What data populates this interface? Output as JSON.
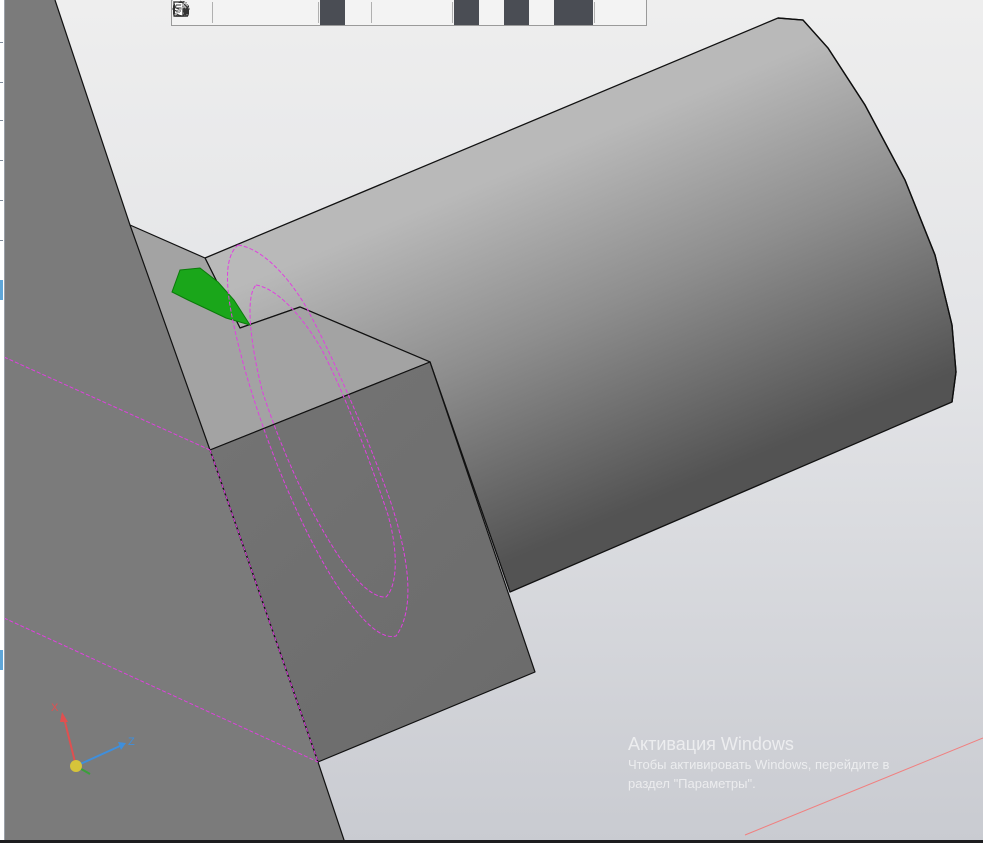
{
  "window": {
    "type": "3d-cad-viewport"
  },
  "toolbar": {
    "buttons": [
      {
        "id": "drag-handle",
        "icon": "grip-icon"
      },
      {
        "id": "orientation",
        "icon": "orientation-icon",
        "has_dropdown": false
      },
      {
        "id": "zoom",
        "icon": "zoom-icon",
        "has_dropdown": true
      },
      {
        "id": "normal-to",
        "icon": "normal-view-icon",
        "has_dropdown": false
      },
      {
        "id": "coordinate-system",
        "icon": "axes-icon",
        "has_dropdown": true
      },
      {
        "id": "shaded",
        "icon": "shaded-cube-icon",
        "active": true
      },
      {
        "id": "wireframe",
        "icon": "wireframe-cube-icon",
        "active": false
      },
      {
        "id": "visibility",
        "icon": "eye-icon",
        "has_dropdown": true
      },
      {
        "id": "display-mode",
        "icon": "camera-icon",
        "has_dropdown": true
      },
      {
        "id": "selection-1",
        "icon": "selection-arrows-icon",
        "active": true
      },
      {
        "id": "selection-2",
        "icon": "sheet-icon",
        "active": false
      },
      {
        "id": "selection-3",
        "icon": "filter-doc-icon",
        "active": true
      },
      {
        "id": "selection-4",
        "icon": "layers-icon",
        "active": false
      },
      {
        "id": "filter",
        "icon": "filter-icon",
        "active": true,
        "has_dropdown": true
      },
      {
        "id": "properties",
        "icon": "properties-icon",
        "active": false
      },
      {
        "id": "eyedropper",
        "icon": "eyedropper-icon",
        "active": false,
        "disabled": true
      }
    ]
  },
  "triad": {
    "x_label": "X",
    "z_label": "Z",
    "x_color": "#e05050",
    "z_color": "#3f8fdc",
    "y_color": "#3aa03a",
    "origin_color": "#d6c43a"
  },
  "watermark": {
    "title": "Активация Windows",
    "line1": "Чтобы активировать Windows, перейдите в",
    "line2": "раздел \"Параметры\"."
  },
  "colors": {
    "selection_face": "#1aa61a",
    "sketch_curve": "#e040e0",
    "body_gray": "#7b7b7b",
    "edge": "#111111"
  }
}
